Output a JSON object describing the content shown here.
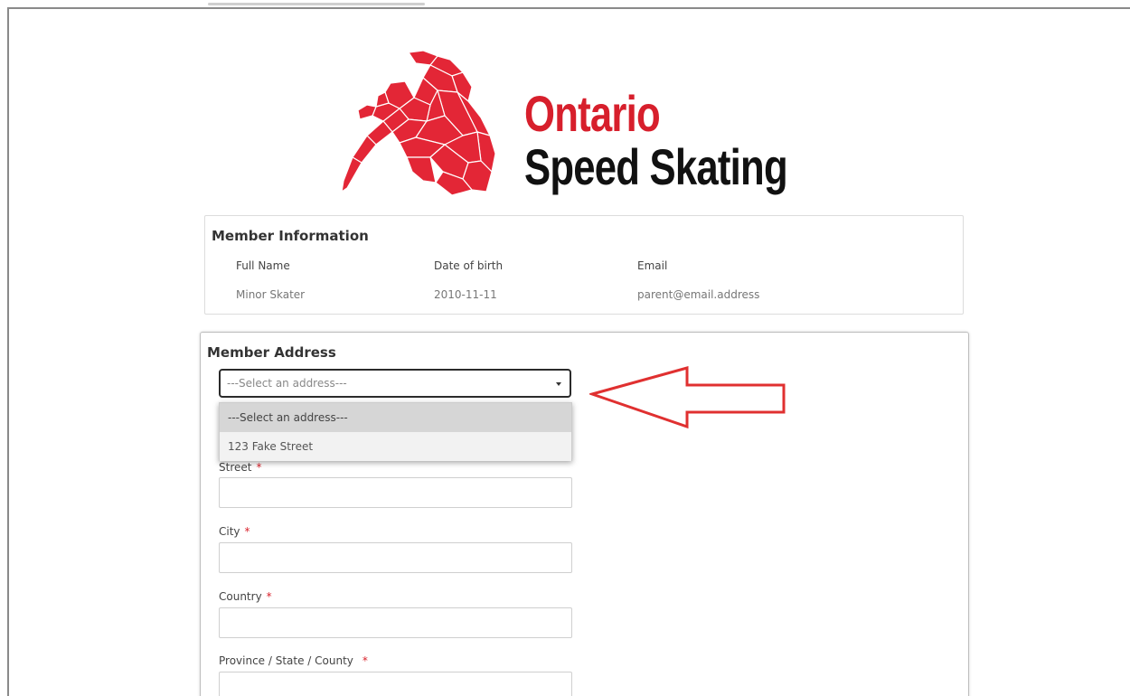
{
  "logo": {
    "line1": "Ontario",
    "line2": "Speed Skating",
    "brand_red": "#d71f2c"
  },
  "member_info": {
    "title": "Member Information",
    "headers": [
      "Full Name",
      "Date of birth",
      "Email"
    ],
    "values": [
      "Minor Skater",
      "2010-11-11",
      "parent@email.address"
    ]
  },
  "member_address": {
    "title": "Member Address",
    "select": {
      "value": "---Select an address---",
      "options": [
        "---Select an address---",
        "123 Fake Street"
      ]
    },
    "fields": [
      {
        "label": "Street",
        "required": "*",
        "value": ""
      },
      {
        "label": "City",
        "required": "*",
        "value": ""
      },
      {
        "label": "Country",
        "required": "*",
        "value": ""
      },
      {
        "label": "Province / State / County",
        "required": "*",
        "value": ""
      }
    ]
  },
  "annotation": {
    "arrow_color": "#e03030",
    "arrow_direction": "left"
  }
}
